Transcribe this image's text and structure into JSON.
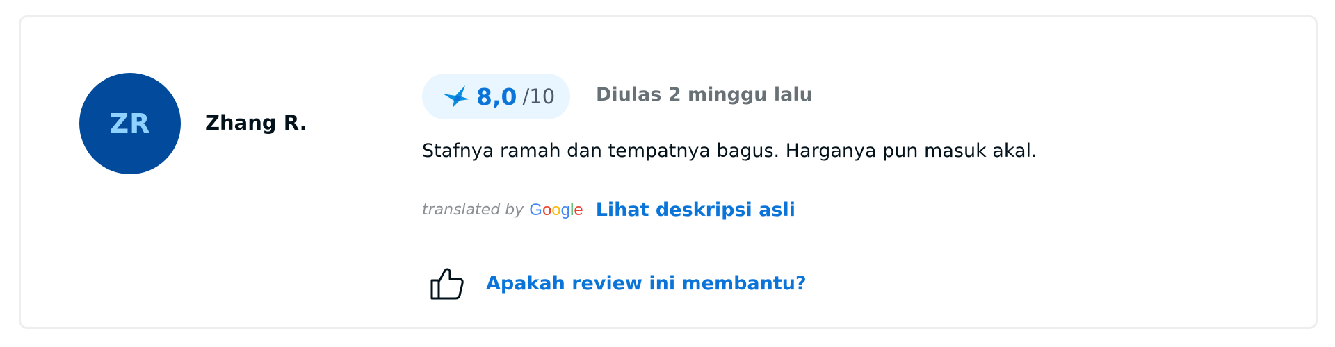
{
  "review": {
    "avatar_initials": "ZR",
    "reviewer_name": "Zhang R.",
    "score": {
      "value": "8,0",
      "max": "/10",
      "icon": "traveloka-bird-icon"
    },
    "date_text": "Diulas 2 minggu lalu",
    "text": "Stafnya ramah dan tempatnya bagus. Harganya pun masuk akal.",
    "translation": {
      "translated_by": "translated by",
      "provider_logo": "Google",
      "see_original_label": "Lihat deskripsi asli"
    },
    "helpful": {
      "icon": "thumbs-up-icon",
      "label": "Apakah review ini membantu?"
    }
  },
  "colors": {
    "avatar_bg": "#014a9c",
    "avatar_text": "#8fd2ff",
    "accent": "#0a74d8",
    "badge_bg": "#e9f6ff",
    "muted_text": "#687176"
  }
}
